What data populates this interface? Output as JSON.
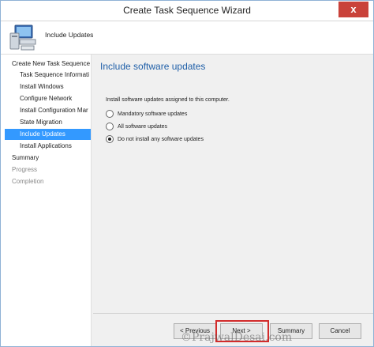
{
  "window": {
    "title": "Create Task Sequence Wizard",
    "close_glyph": "x"
  },
  "header": {
    "title": "Include Updates",
    "icon": "computer-icon"
  },
  "sidebar": {
    "items": [
      {
        "label": "Create New Task Sequence",
        "state": "normal"
      },
      {
        "label": "Task Sequence Informati",
        "state": "normal"
      },
      {
        "label": "Install Windows",
        "state": "normal"
      },
      {
        "label": "Configure Network",
        "state": "normal"
      },
      {
        "label": "Install Configuration Mar",
        "state": "normal"
      },
      {
        "label": "State Migration",
        "state": "normal"
      },
      {
        "label": "Include Updates",
        "state": "active"
      },
      {
        "label": "Install Applications",
        "state": "normal"
      },
      {
        "label": "Summary",
        "state": "normal"
      },
      {
        "label": "Progress",
        "state": "disabled"
      },
      {
        "label": "Completion",
        "state": "disabled"
      }
    ]
  },
  "main": {
    "title": "Include software updates",
    "instruction": "Install software updates assigned to this computer.",
    "options": [
      {
        "label": "Mandatory software updates",
        "checked": false
      },
      {
        "label": "All software updates",
        "checked": false
      },
      {
        "label": "Do not install any software updates",
        "checked": true
      }
    ]
  },
  "buttons": {
    "previous": "< Previous",
    "next": "Next >",
    "summary": "Summary",
    "cancel": "Cancel"
  },
  "watermark": "©PrajwalDesai.com",
  "colors": {
    "active_item": "#3399ff",
    "title_blue": "#1f5fa8",
    "highlight_red": "#d22b2b",
    "close_red": "#c9423a"
  }
}
